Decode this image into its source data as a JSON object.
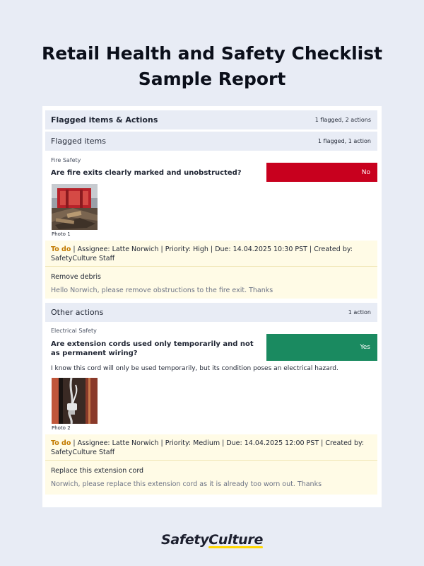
{
  "title": {
    "line1": "Retail Health and Safety Checklist",
    "line2": "Sample Report"
  },
  "flagged_section": {
    "header": "Flagged items & Actions",
    "header_count": "1 flagged, 2 actions",
    "sub_header": "Flagged items",
    "sub_count": "1 flagged, 1 action"
  },
  "item1": {
    "category": "Fire Safety",
    "question": "Are fire exits clearly marked and unobstructed?",
    "answer": "No",
    "answer_color": "#c8001e",
    "photo_caption": "Photo 1",
    "action": {
      "status": "To do",
      "details": " | Assignee: Latte Norwich | Priority: High | Due: 14.04.2025 10:30 PST | Created by: SafetyCulture Staff",
      "title": "Remove debris",
      "description": "Hello Norwich, please remove obstructions to the fire exit. Thanks"
    }
  },
  "other_section": {
    "header": "Other actions",
    "count": "1 action"
  },
  "item2": {
    "category": "Electrical Safety",
    "question": "Are extension cords used only temporarily and not as permanent wiring?",
    "answer": "Yes",
    "answer_color": "#1a8a60",
    "note": "I know this cord will only be used temporarily, but its condition poses an electrical hazard.",
    "photo_caption": "Photo 2",
    "action": {
      "status": "To do",
      "details": " | Assignee: Latte Norwich | Priority: Medium | Due: 14.04.2025 12:00 PST | Created by: SafetyCulture Staff",
      "title": "Replace this extension cord",
      "description": "Norwich, please replace this extension cord as it is already too worn out. Thanks"
    }
  },
  "brand": {
    "part1": "Safety",
    "part2": "Culture"
  }
}
